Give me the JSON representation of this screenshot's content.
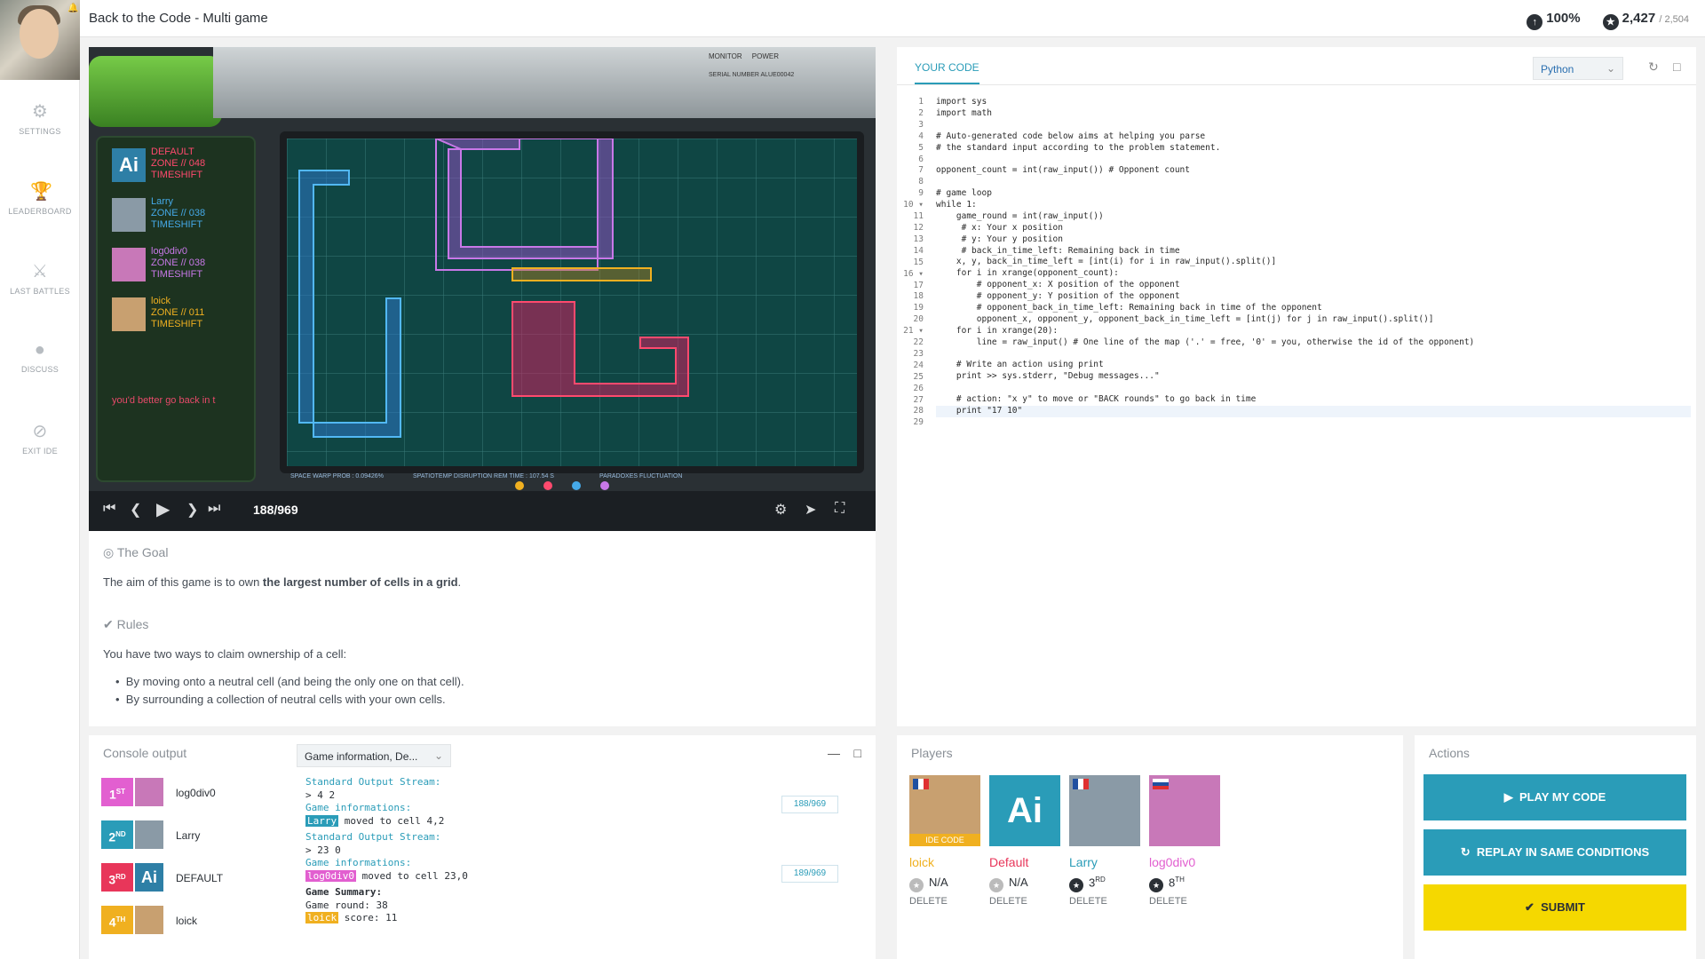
{
  "header": {
    "title": "Back to the Code - Multi game",
    "progress": "100%",
    "score": "2,427",
    "score_total": "/ 2,504"
  },
  "nav": [
    {
      "label": "SETTINGS",
      "icon": "gear-icon"
    },
    {
      "label": "LEADERBOARD",
      "icon": "trophy-icon"
    },
    {
      "label": "LAST BATTLES",
      "icon": "battle-icon"
    },
    {
      "label": "DISCUSS",
      "icon": "chat-icon"
    },
    {
      "label": "EXIT IDE",
      "icon": "exit-icon"
    }
  ],
  "viewer": {
    "monitor": "MONITOR",
    "power": "POWER",
    "serial": "SERIAL NUMBER   ALUE00042",
    "players": [
      {
        "name": "DEFAULT",
        "zone": "ZONE // 048",
        "ts": "TIMESHIFT",
        "color": "#ff4a6e"
      },
      {
        "name": "Larry",
        "zone": "ZONE // 038",
        "ts": "TIMESHIFT",
        "color": "#45a9e8"
      },
      {
        "name": "log0div0",
        "zone": "ZONE // 038",
        "ts": "TIMESHIFT",
        "color": "#c878e8"
      },
      {
        "name": "loick",
        "zone": "ZONE // 011",
        "ts": "TIMESHIFT",
        "color": "#f0b020"
      }
    ],
    "message": "you'd better go back in t",
    "hud": {
      "left": "SPACE WARP PROB : 0.09426%",
      "mid": "SPATIOTEMP DISRUPTION REM TIME : 107.54 S",
      "right": "PARADOXES FLUCTUATION"
    },
    "frame": "188/969"
  },
  "statement": {
    "goal_heading": "The Goal",
    "goal_prefix": "The aim of this game is to own ",
    "goal_bold": "the largest number of cells in a grid",
    "goal_suffix": ".",
    "rules_heading": "Rules",
    "rules_intro": "You have two ways to claim ownership of a cell:",
    "rules": [
      "By moving onto a neutral cell (and being the only one on that cell).",
      "By surrounding a collection of neutral cells with your own cells."
    ]
  },
  "code": {
    "tab": "YOUR CODE",
    "language": "Python",
    "lines": [
      "import sys",
      "import math",
      "",
      "# Auto-generated code below aims at helping you parse",
      "# the standard input according to the problem statement.",
      "",
      "opponent_count = int(raw_input()) # Opponent count",
      "",
      "# game loop",
      "while 1:",
      "    game_round = int(raw_input())",
      "     # x: Your x position",
      "     # y: Your y position",
      "     # back_in_time_left: Remaining back in time",
      "    x, y, back_in_time_left = [int(i) for i in raw_input().split()]",
      "    for i in xrange(opponent_count):",
      "        # opponent_x: X position of the opponent",
      "        # opponent_y: Y position of the opponent",
      "        # opponent_back_in_time_left: Remaining back in time of the opponent",
      "        opponent_x, opponent_y, opponent_back_in_time_left = [int(j) for j in raw_input().split()]",
      "    for i in xrange(20):",
      "        line = raw_input() # One line of the map ('.' = free, '0' = you, otherwise the id of the opponent)",
      "",
      "    # Write an action using print",
      "    print >> sys.stderr, \"Debug messages...\"",
      "",
      "    # action: \"x y\" to move or \"BACK rounds\" to go back in time",
      "    print \"17 10\"",
      ""
    ],
    "fold_lines": [
      10,
      16,
      21
    ],
    "active_line": 28
  },
  "console": {
    "heading": "Console output",
    "select": "Game information, De...",
    "ranks": [
      {
        "rank": "1",
        "suffix": "ST",
        "name": "log0div0",
        "color": "#e25fd0"
      },
      {
        "rank": "2",
        "suffix": "ND",
        "name": "Larry",
        "color": "#2a9cb8"
      },
      {
        "rank": "3",
        "suffix": "RD",
        "name": "DEFAULT",
        "color": "#e8365a"
      },
      {
        "rank": "4",
        "suffix": "TH",
        "name": "loick",
        "color": "#f0b020"
      }
    ],
    "log": {
      "s1": "Standard Output Stream:",
      "o1": "> 4 2",
      "g1": "Game informations:",
      "g1_name": "Larry",
      "g1_text": " moved to cell 4,2",
      "s2": "Standard Output Stream:",
      "o2": "> 23 0",
      "g2": "Game informations:",
      "g2_name": "log0div0",
      "g2_text": " moved to cell 23,0",
      "summary": "Game Summary:",
      "round": "Game round: 38",
      "score_name": "loick",
      "score_text": " score: 11"
    },
    "frame_tags": [
      "188/969",
      "189/969"
    ]
  },
  "players_panel": {
    "heading": "Players",
    "players": [
      {
        "name": "loick",
        "rank": "N/A",
        "rank_suffix": "",
        "color": "#f0b020",
        "delete": "DELETE",
        "badge": "IDE CODE"
      },
      {
        "name": "Default",
        "rank": "N/A",
        "rank_suffix": "",
        "color": "#e8365a",
        "delete": "DELETE"
      },
      {
        "name": "Larry",
        "rank": "3",
        "rank_suffix": "RD",
        "color": "#2a9cb8",
        "delete": "DELETE"
      },
      {
        "name": "log0div0",
        "rank": "8",
        "rank_suffix": "TH",
        "color": "#e25fd0",
        "delete": "DELETE"
      }
    ]
  },
  "actions": {
    "heading": "Actions",
    "play": "PLAY MY CODE",
    "replay": "REPLAY IN SAME CONDITIONS",
    "submit": "SUBMIT"
  }
}
